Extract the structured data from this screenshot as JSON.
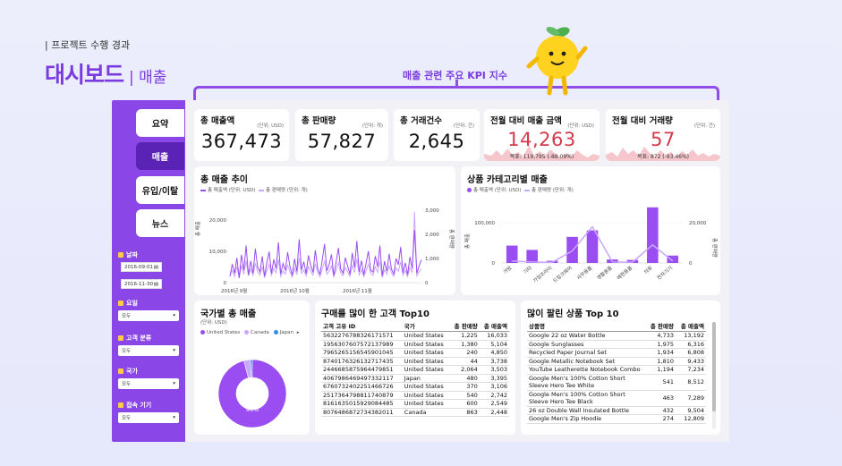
{
  "header": {
    "crumb": "| 프로젝트 수행 경과",
    "title": "대시보드",
    "subtitle": "| 매출",
    "kpi_caption": "매출 관련 주요 KPI 지수"
  },
  "sidebar": {
    "nav": [
      {
        "label": "요약",
        "active": false
      },
      {
        "label": "매출",
        "active": true
      },
      {
        "label": "유입/이탈",
        "active": false
      },
      {
        "label": "뉴스",
        "active": false
      }
    ],
    "date_label": "날짜",
    "date_start": "2016-09-01",
    "date_end": "2016-11-30",
    "filters": [
      {
        "label": "요일",
        "value": "모두"
      },
      {
        "label": "고객 분류",
        "value": "모두"
      },
      {
        "label": "국가",
        "value": "모두"
      },
      {
        "label": "접속 기기",
        "value": "모두"
      }
    ]
  },
  "kpis": [
    {
      "title": "총 매출액",
      "unit": "(단위: USD)",
      "value": "367,473",
      "target": "",
      "alert": false
    },
    {
      "title": "총 판매량",
      "unit": "(단위: 개)",
      "value": "57,827",
      "target": "",
      "alert": false
    },
    {
      "title": "총 거래건수",
      "unit": "(단위: 건)",
      "value": "2,645",
      "target": "",
      "alert": false
    },
    {
      "title": "전월 대비 매출 금액",
      "unit": "(단위: USD)",
      "value": "14,263",
      "target": "목표: 119,795 (-88.09%)",
      "alert": true
    },
    {
      "title": "전월 대비 거래량",
      "unit": "(단위: 건)",
      "value": "57",
      "target": "목표: 872 (-93.46%)",
      "alert": true
    }
  ],
  "trend": {
    "title": "총 매출 추이",
    "legend_sales": "총 매출액 (단위: USD)",
    "legend_qty": "총 판매량 (단위: 개)",
    "ylabel_left": "총 매출",
    "ylabel_right": "총 판매량",
    "yticks_left": [
      "0",
      "10,000",
      "20,000"
    ],
    "yticks_right": [
      "0",
      "1,000",
      "2,000",
      "3,000"
    ],
    "xticks": [
      "2016년 9월",
      "2016년 10월",
      "2016년 11월"
    ]
  },
  "category": {
    "title": "상품 카테고리별 매출",
    "legend_sales": "총 매출액 (단위: USD)",
    "legend_qty": "총 판매량 (단위: 개)",
    "ylabel_left": "총 매출",
    "ylabel_right": "총 판매량",
    "yticks_left": [
      "0",
      "100,000"
    ],
    "yticks_right": [
      "0",
      "20,000"
    ]
  },
  "country": {
    "title": "국가별 총 매출",
    "unit": "(단위: USD)",
    "legend": [
      {
        "name": "United States",
        "color": "#9a4df0"
      },
      {
        "name": "Canada",
        "color": "#c9a6ff"
      },
      {
        "name": "Japan",
        "color": "#2f8ff0"
      }
    ],
    "label": "96%"
  },
  "customers": {
    "title": "구매를 많이 한 고객 Top10",
    "headers": [
      "고객 고유 ID",
      "국가",
      "총 판매량",
      "총 매출액"
    ],
    "rows": [
      [
        "5632276788326171571",
        "United States",
        "1,225",
        "16,033"
      ],
      [
        "1956307607572137989",
        "United States",
        "1,380",
        "5,104"
      ],
      [
        "7965265156545901045",
        "United States",
        "240",
        "4,850"
      ],
      [
        "8740176326132717435",
        "United States",
        "44",
        "3,738"
      ],
      [
        "2446685875964479851",
        "United States",
        "2,064",
        "3,503"
      ],
      [
        "4067986469497332117",
        "Japan",
        "480",
        "3,395"
      ],
      [
        "6760732402251466726",
        "United States",
        "370",
        "3,106"
      ],
      [
        "2517364798811740879",
        "United States",
        "540",
        "2,742"
      ],
      [
        "8161635015929084485",
        "United States",
        "600",
        "2,549"
      ],
      [
        "8076486872734382011",
        "Canada",
        "863",
        "2,448"
      ]
    ]
  },
  "products": {
    "title": "많이 팔린 상품 Top 10",
    "headers": [
      "상품명",
      "총 판매량",
      "총 매출액"
    ],
    "rows": [
      [
        "Google 22 oz Water Bottle",
        "4,733",
        "13,192"
      ],
      [
        "Google Sunglasses",
        "1,975",
        "6,316"
      ],
      [
        "Recycled Paper Journal Set",
        "1,934",
        "6,808"
      ],
      [
        "Google Metallic Notebook Set",
        "1,810",
        "9,433"
      ],
      [
        "YouTube Leatherette Notebook Combo",
        "1,194",
        "7,234"
      ],
      [
        "Google Men's 100% Cotton Short Sleeve Hero Tee White",
        "541",
        "8,512"
      ],
      [
        "Google Men's 100% Cotton Short Sleeve Hero Tee Black",
        "463",
        "7,289"
      ],
      [
        "26 oz Double Wall Insulated Bottle",
        "432",
        "9,504"
      ],
      [
        "Google Men's Zip Hoodie",
        "274",
        "12,809"
      ]
    ]
  },
  "chart_data": [
    {
      "type": "bar",
      "title": "상품 카테고리별 매출",
      "categories": [
        "가방",
        "기타",
        "가정프라이",
        "드링크웨어",
        "사무용품",
        "생활용품",
        "예편용품",
        "의류",
        "전자기기"
      ],
      "series": [
        {
          "name": "총 매출액 (단위: USD)",
          "values": [
            40000,
            30000,
            5000,
            60000,
            75000,
            8000,
            7000,
            128000,
            17000
          ]
        },
        {
          "name": "총 판매량 (단위: 개)",
          "values": [
            1000,
            500,
            300,
            6000,
            18000,
            500,
            400,
            9000,
            1000
          ]
        }
      ],
      "ylim": [
        0,
        140000
      ]
    },
    {
      "type": "pie",
      "title": "국가별 총 매출",
      "categories": [
        "United States",
        "Canada",
        "Japan"
      ],
      "values": [
        96,
        3,
        1
      ]
    },
    {
      "type": "line",
      "title": "총 매출 추이",
      "series": [
        {
          "name": "총 매출액 (단위: USD)",
          "values": [
            2000,
            6000,
            3000,
            8000,
            1500,
            9000,
            4000,
            12000,
            2500,
            7000,
            3000,
            11000,
            5000,
            3500,
            8500,
            2000,
            6500,
            10000,
            3000,
            7500,
            4500,
            13000,
            2800,
            6200,
            3900,
            9800,
            5200,
            2400,
            7700,
            3600,
            14000,
            4100,
            6800,
            2900,
            8800,
            5600,
            3300,
            10500,
            4700,
            2600,
            7300,
            12500,
            3800,
            5900,
            9100,
            2300,
            6600,
            11200,
            4300,
            3100,
            8100,
            5400,
            2700,
            9600,
            4900,
            13500,
            3500,
            7100,
            2500,
            6300,
            10200,
            4000,
            3400,
            8600,
            5100,
            12000,
            2200,
            6900,
            3700,
            9300,
            4400,
            2800,
            7800,
            5800,
            11500,
            3200,
            6400,
            2600,
            8300,
            4600,
            17000,
            3000,
            5500,
            7400
          ]
        },
        {
          "name": "총 판매량 (단위: 개)",
          "values": [
            300,
            500,
            250,
            650,
            200,
            700,
            350,
            900,
            280,
            550,
            300,
            800,
            450,
            320,
            650,
            220,
            500,
            760,
            300,
            580,
            400,
            950,
            260,
            480,
            350,
            720,
            440,
            230,
            590,
            330,
            1000,
            380,
            520,
            270,
            660,
            460,
            310,
            780,
            420,
            240,
            560,
            900,
            350,
            470,
            690,
            230,
            510,
            820,
            390,
            290,
            620,
            440,
            260,
            710,
            420,
            980,
            320,
            540,
            240,
            490,
            760,
            370,
            310,
            650,
            430,
            870,
            210,
            530,
            340,
            690,
            400,
            260,
            600,
            470,
            850,
            300,
            500,
            250,
            630,
            410,
            2900,
            280,
            450,
            560
          ]
        }
      ]
    }
  ]
}
